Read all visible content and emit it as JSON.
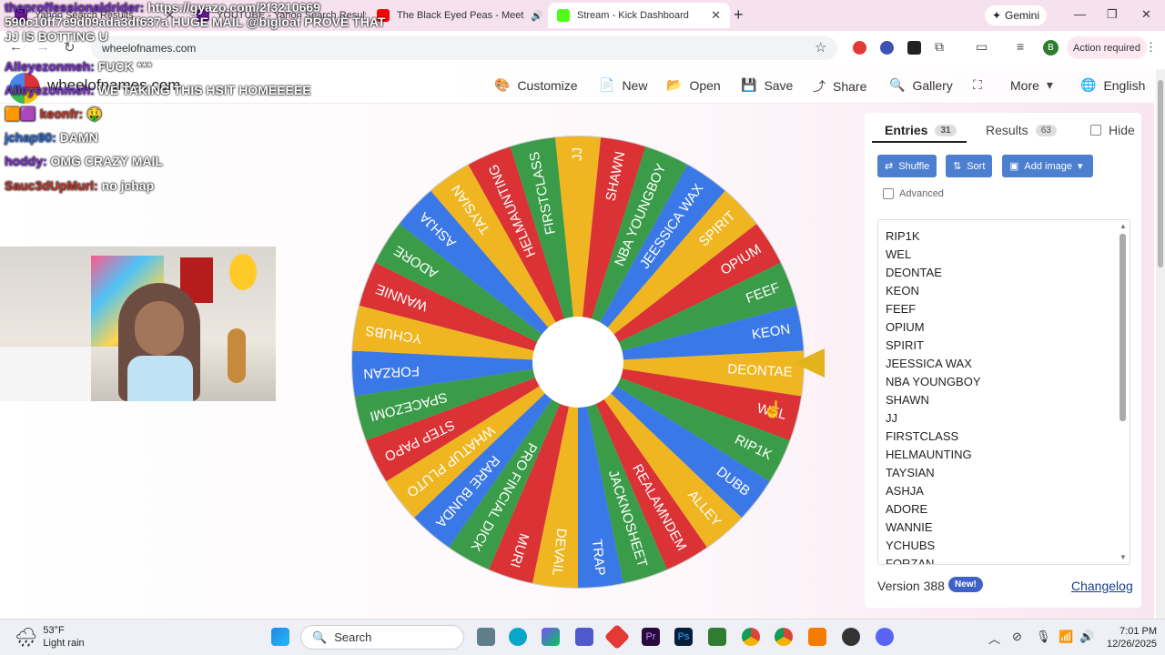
{
  "browser": {
    "tabs": [
      {
        "label": "Yahoo Search Results",
        "active": false
      },
      {
        "label": "YOUTUBE - Yahoo Search Results",
        "active": false
      },
      {
        "label": "The Black Eyed Peas - Meet",
        "active": false
      },
      {
        "label": "Stream - Kick Dashboard",
        "active": true
      }
    ],
    "new_tab": "+",
    "gemini": "Gemini",
    "url": "wheelofnames.com",
    "profile_initial": "B",
    "action_required": "Action required"
  },
  "site": {
    "name": "wheelofnames.com",
    "toolbar": [
      {
        "icon": "palette-icon",
        "label": "Customize"
      },
      {
        "icon": "file-icon",
        "label": "New"
      },
      {
        "icon": "folder-icon",
        "label": "Open"
      },
      {
        "icon": "save-icon",
        "label": "Save"
      },
      {
        "icon": "share-icon",
        "label": "Share"
      },
      {
        "icon": "search-icon",
        "label": "Gallery"
      },
      {
        "icon": "fullscreen-icon",
        "label": ""
      },
      {
        "icon": "chevron-down-icon",
        "label": "More"
      },
      {
        "icon": "globe-icon",
        "label": "English"
      }
    ]
  },
  "chat_overlay": {
    "lines": [
      {
        "user": "theproffessionaldrider:",
        "message": "https://gyazo.com/2f3210669 590c10ff7e9d09ada3df637a HUGE MAIL @bigloaf PROVE THAT JJ IS BOTTING U"
      },
      {
        "user": "Alleyezonmeh:",
        "message": "FUCK ***"
      },
      {
        "user": "Alleyezonmeh:",
        "message": "WE TAKING THIS HSIT HOMEEEEE"
      },
      {
        "user": "keonfr:",
        "message": "🤑"
      },
      {
        "user": "jchap90:",
        "message": "DAMN"
      },
      {
        "user": "hoddy:",
        "message": "OMG CRAZY MAIL"
      },
      {
        "user": "Sauc3dUpMurl:",
        "message": "no jchap"
      }
    ]
  },
  "wheel": {
    "segments": [
      "JJ",
      "SHAWN",
      "NBA YOUNGBOY",
      "JEESSICA WAX",
      "SPIRIT",
      "OPIUM",
      "FEEF",
      "KEON",
      "DEONTAE",
      "WEL",
      "RIP1K",
      "DUBB",
      "ALLEY",
      "REALAMNDEM",
      "JACKNOSHEET",
      "TRAP",
      "DEVAIL",
      "MURI",
      "PRO FINCIAL DICK",
      "RARE BUNDA",
      "WHATUP PLUTO",
      "STEP PAPO",
      "SPACEZOMI",
      "FORZAN",
      "YCHUBS",
      "WANNIE",
      "ADORE",
      "ASHJA",
      "TAYSIAN",
      "HELMAUNTING",
      "FIRSTCLASS"
    ],
    "colors": [
      "#efb622",
      "#db3236",
      "#3a9c48",
      "#3b78e7"
    ]
  },
  "panel": {
    "entries_tab": "Entries",
    "entries_count": "31",
    "results_tab": "Results",
    "results_count": "63",
    "hide_label": "Hide",
    "shuffle_label": "Shuffle",
    "sort_label": "Sort",
    "add_image_label": "Add image",
    "advanced_label": "Advanced",
    "entries": [
      "RIP1K",
      "WEL",
      "DEONTAE",
      "KEON",
      "FEEF",
      "OPIUM",
      "SPIRIT",
      "JEESSICA WAX",
      "NBA YOUNGBOY",
      "SHAWN",
      "JJ",
      "FIRSTCLASS",
      "HELMAUNTING",
      "TAYSIAN",
      "ASHJA",
      "ADORE",
      "WANNIE",
      "YCHUBS",
      "FORZAN"
    ],
    "version": "Version 388",
    "new_badge": "New!",
    "changelog": "Changelog"
  },
  "taskbar": {
    "temperature": "53°F",
    "weather": "Light rain",
    "search_placeholder": "Search",
    "time": "7:01 PM",
    "date": "12/26/2025"
  }
}
